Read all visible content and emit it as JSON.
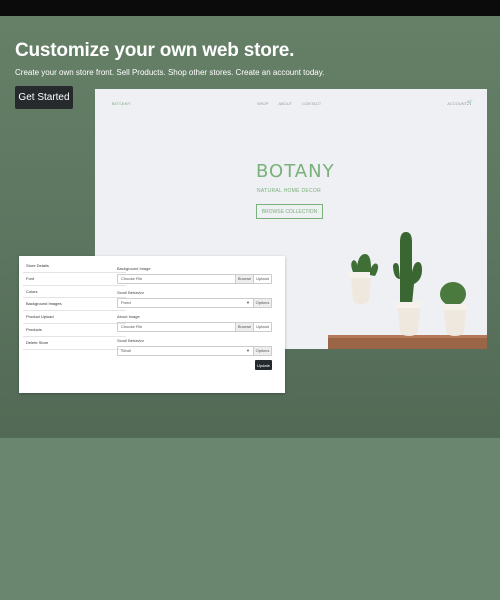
{
  "hero": {
    "headline": "Customize your own web store.",
    "subline": "Create your own store front. Sell Products. Shop other stores. Create an account today.",
    "cta_label": "Get Started"
  },
  "preview": {
    "logo": "BOTANY",
    "nav": [
      "SHOP",
      "ABOUT",
      "CONTACT"
    ],
    "account": "ACCOUNT",
    "brand": "BOTANY",
    "tagline": "NATURAL HOME DECOR",
    "button": "BROWSE COLLECTION",
    "accent_color": "#7ab07a",
    "cart_icon": "cart-icon"
  },
  "settings": {
    "sidebar": [
      "Store Details",
      "Font",
      "Colors",
      "Background Images",
      "Product Upload",
      "Products",
      "Delete Store"
    ],
    "fields": [
      {
        "label": "Background Image",
        "value": "Choose File",
        "browse": "Browse",
        "upload": "Upload"
      },
      {
        "label": "Scroll Behavior",
        "value": "Fixed",
        "options": "Options"
      },
      {
        "label": "About Image",
        "value": "Choose File",
        "browse": "Browse",
        "upload": "Upload"
      },
      {
        "label": "Scroll Behavior",
        "value": "Scroll",
        "options": "Options"
      }
    ],
    "update_label": "Update"
  }
}
